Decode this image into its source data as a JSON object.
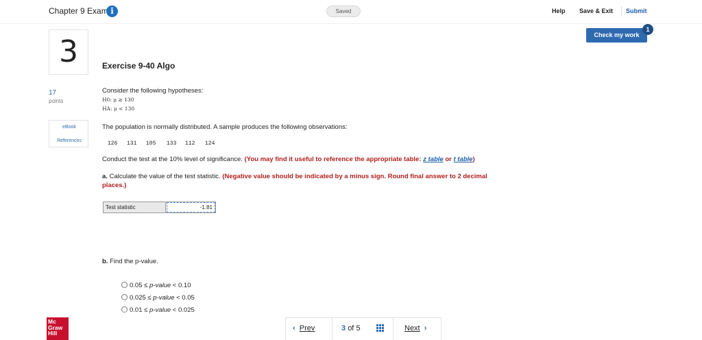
{
  "header": {
    "exam_title": "Chapter 9 Exam",
    "saved_status": "Saved",
    "help": "Help",
    "save_exit": "Save & Exit",
    "submit": "Submit",
    "check_my_work": "Check my work",
    "check_badge": "1"
  },
  "question": {
    "number": "3",
    "points": "17",
    "points_label": "points",
    "references": [
      "eBook",
      "References"
    ]
  },
  "exercise": {
    "title": "Exercise 9-40 Algo",
    "intro": "Consider the following hypotheses:",
    "h0": "H0: μ ≥ 130",
    "ha": "HA: μ < 130",
    "population_text": "The population is normally distributed. A sample produces the following observations:",
    "observations": [
      "126",
      "131",
      "105",
      "133",
      "112",
      "124"
    ],
    "conduct_text": "Conduct the test at the 10% level of significance.",
    "conduct_hint": "(You may find it useful to reference the appropriate table:",
    "z_table": "z table",
    "or": "or",
    "t_table": "t table",
    "close_paren": ")",
    "part_a_label": "a.",
    "part_a_text": "Calculate the value of the test statistic.",
    "part_a_hint_line1": "(Negative value should be indicated by a minus sign. Round final answer to 2 decimal",
    "part_a_hint_line2": "places.)",
    "test_stat_label": "Test statistic",
    "test_stat_value": "-1.81",
    "part_b_label": "b.",
    "part_b_text": "Find the p-value.",
    "options": [
      {
        "low": "0.05",
        "high": "0.10"
      },
      {
        "low": "0.025",
        "high": "0.05"
      },
      {
        "low": "0.01",
        "high": "0.025"
      }
    ],
    "pvalue_word": "p-value"
  },
  "footer": {
    "logo": [
      "Mc",
      "Graw",
      "Hill"
    ],
    "prev": "Prev",
    "current_page": "3",
    "of_label": "of",
    "total_pages": "5",
    "next": "Next"
  }
}
